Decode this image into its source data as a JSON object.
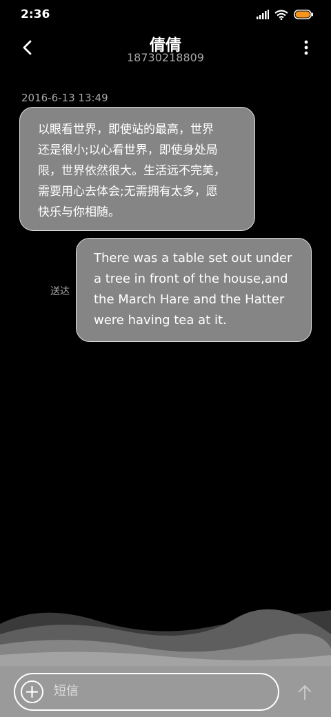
{
  "status_bar": {
    "time": "2:36"
  },
  "header": {
    "contact_name": "倩倩",
    "contact_number": "18730218809"
  },
  "conversation": {
    "timestamp": "2016-6-13 13:49",
    "messages": [
      {
        "direction": "incoming",
        "lines": [
          "以眼看世界，即使站的最高，世界",
          "还是很小;以心看世界，即使身处局",
          "限，世界依然很大。生活远不完美，",
          "需要用心去体会;无需拥有太多，愿",
          "快乐与你相随。"
        ]
      },
      {
        "direction": "outgoing",
        "lines": [
          "There was a table set out under",
          "a tree in front of the house,and",
          "the March Hare and the Hatter",
          "were having tea at it."
        ],
        "status": "送达"
      }
    ]
  },
  "composer": {
    "placeholder": "短信"
  },
  "colors": {
    "background": "#000000",
    "bubble": "#858585",
    "input_bar": "#9a9a9a"
  }
}
